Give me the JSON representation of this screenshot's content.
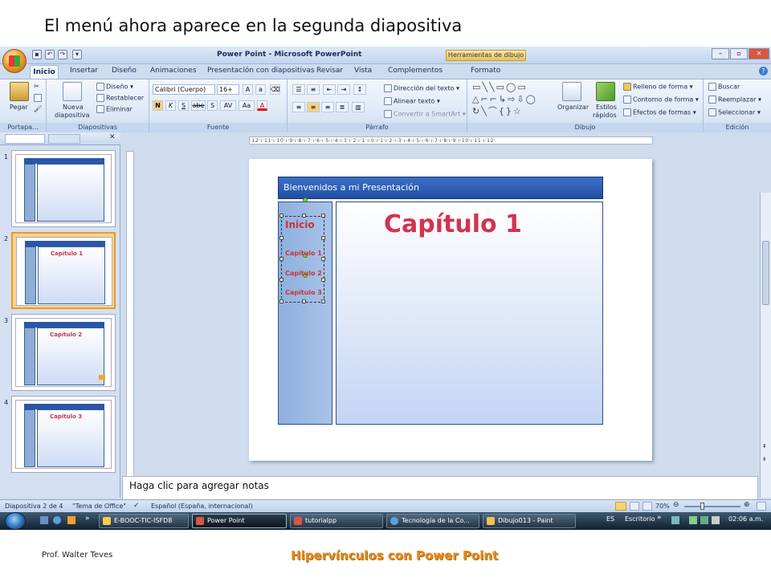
{
  "heading": "El menú ahora aparece en la segunda diapositiva",
  "window": {
    "title": "Power Point - Microsoft PowerPoint",
    "context_tab": "Herramientas de dibujo"
  },
  "tabs": [
    "Inicio",
    "Insertar",
    "Diseño",
    "Animaciones",
    "Presentación con diapositivas",
    "Revisar",
    "Vista",
    "Complementos",
    "Formato"
  ],
  "ribbon": {
    "portapapeles": {
      "label": "Portapa...",
      "pegar": "Pegar"
    },
    "diapositivas": {
      "label": "Diapositivas",
      "nueva": "Nueva",
      "nueva2": "diapositiva",
      "diseno": "Diseño",
      "restablecer": "Restablecer",
      "eliminar": "Eliminar"
    },
    "fuente": {
      "label": "Fuente",
      "font": "Calibri (Cuerpo)",
      "size": "16+",
      "bold": "N",
      "italic": "K",
      "underline": "S",
      "strike": "abe",
      "shadow": "S",
      "spacing": "AV",
      "case": "Aa",
      "color": "A"
    },
    "parrafo": {
      "label": "Párrafo",
      "direccion": "Dirección del texto",
      "alinear": "Alinear texto",
      "convertir": "Convertir a SmartArt"
    },
    "dibujo": {
      "label": "Dibujo",
      "organizar": "Organizar",
      "estilos": "Estilos",
      "rapidos": "rápidos",
      "relleno": "Relleno de forma",
      "contorno": "Contorno de forma",
      "efectos": "Efectos de formas"
    },
    "edicion": {
      "label": "Edición",
      "buscar": "Buscar",
      "reemplazar": "Reemplazar",
      "seleccionar": "Seleccionar"
    }
  },
  "thumbnails": [
    {
      "num": "1",
      "caption": ""
    },
    {
      "num": "2",
      "caption": "Capítulo 1"
    },
    {
      "num": "3",
      "caption": "Capítulo 2"
    },
    {
      "num": "4",
      "caption": "Capítulo 3"
    }
  ],
  "ruler": "·12·ı·11·ı·10·ı·9·ı·8·ı·7·ı·6·ı·5·ı·4·ı·3·ı·2·ı·1·ı·0·ı·1·ı·2·ı·3·ı·4·ı·5·ı·6·ı·7·ı·8·ı·9·ı·10·ı·11·ı·12·",
  "slide": {
    "title": "Bienvenidos a mi Presentación",
    "chapter": "Capítulo 1",
    "menu": [
      "Inicio",
      "Capítulo 1",
      "Capítulo 2",
      "Capítulo 3"
    ]
  },
  "notes_placeholder": "Haga clic para agregar notas",
  "status": {
    "slide": "Diapositiva 2 de 4",
    "theme": "\"Tema de Office\"",
    "language": "Español (España, internacional)",
    "zoom": "70%"
  },
  "taskbar": {
    "items": [
      "E-BOOC-TIC-ISFD8",
      "Power Point",
      "tutorialpp",
      "Tecnología de la Co...",
      "Dibujo013 - Paint"
    ],
    "lang": "ES",
    "desktop": "Escritorio",
    "clock": "02:06 a.m."
  },
  "footer": {
    "author": "Prof. Walter Teves",
    "topic": "Hipervínculos con Power Point"
  },
  "colors": {
    "accent": "#2050a5",
    "chapter_red": "#d3334f",
    "footer_orange": "#e08a1f"
  }
}
